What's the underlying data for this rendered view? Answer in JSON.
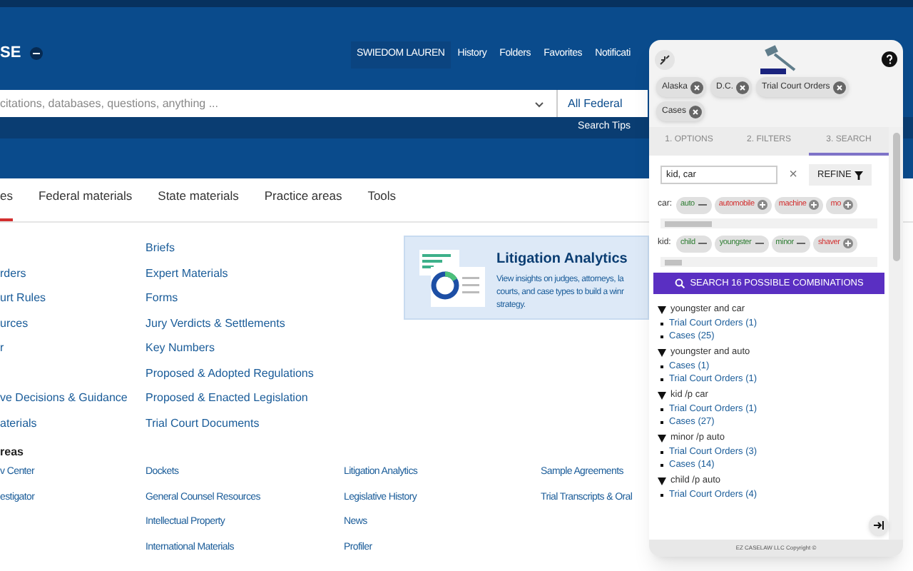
{
  "header": {
    "brand": "SE",
    "nav": [
      {
        "label": "SWIEDOM LAUREN",
        "selected": true
      },
      {
        "label": "History",
        "selected": false
      },
      {
        "label": "Folders",
        "selected": false
      },
      {
        "label": "Favorites",
        "selected": false
      },
      {
        "label": "Notificati",
        "selected": false
      }
    ],
    "search_placeholder": "citations, databases, questions, anything ...",
    "jurisdiction": "All Federal",
    "search_tips": "Search Tips"
  },
  "tabs": [
    {
      "label": "es",
      "selected": true
    },
    {
      "label": "Federal materials",
      "selected": false
    },
    {
      "label": "State materials",
      "selected": false
    },
    {
      "label": "Practice areas",
      "selected": false
    },
    {
      "label": "Tools",
      "selected": false
    }
  ],
  "content_columns": [
    [
      "",
      "rders",
      "urt Rules",
      "urces",
      "r",
      "",
      "ve Decisions & Guidance",
      "aterials"
    ],
    [
      "Briefs",
      "Expert Materials",
      "Forms",
      "Jury Verdicts & Settlements",
      "Key Numbers",
      "Proposed & Adopted Regulations",
      "Proposed & Enacted Legislation",
      "Trial Court Documents"
    ]
  ],
  "promo": {
    "title": "Litigation Analytics",
    "lines": [
      "View insights on judges, attorneys, la",
      "courts, and case types to build a winr",
      "strategy."
    ]
  },
  "section_heading": "reas",
  "section_columns": [
    [
      "v Center",
      "estigator"
    ],
    [
      "Dockets",
      "General Counsel Resources",
      "Intellectual Property",
      "International Materials"
    ],
    [
      "Litigation Analytics",
      "Legislative History",
      "News",
      "Profiler"
    ],
    [
      "Sample Agreements",
      "Trial Transcripts & Oral"
    ]
  ],
  "popup": {
    "filters": [
      "Alaska",
      "D.C.",
      "Trial Court Orders",
      "Cases"
    ],
    "tabs": [
      {
        "label": "1. OPTIONS",
        "selected": false
      },
      {
        "label": "2. FILTERS",
        "selected": false
      },
      {
        "label": "3. SEARCH",
        "selected": true
      }
    ],
    "query": "kid, car",
    "clear": "×",
    "refine": "REFINE",
    "terms": [
      {
        "label": "car:",
        "synonyms": [
          {
            "word": "auto",
            "included": true
          },
          {
            "word": "automobile",
            "included": false
          },
          {
            "word": "machine",
            "included": false
          },
          {
            "word": "mo",
            "included": false
          }
        ]
      },
      {
        "label": "kid:",
        "synonyms": [
          {
            "word": "child",
            "included": true
          },
          {
            "word": "youngster",
            "included": true
          },
          {
            "word": "minor",
            "included": true
          },
          {
            "word": "shaver",
            "included": false
          }
        ]
      }
    ],
    "search_button": "SEARCH 16 POSSIBLE COMBINATIONS",
    "results": [
      {
        "query": "youngster and car",
        "expanded": true,
        "children": [
          "Trial Court Orders (1)",
          "Cases (25)"
        ]
      },
      {
        "query": "youngster and auto",
        "expanded": true,
        "children": [
          "Cases (1)",
          "Trial Court Orders (1)"
        ]
      },
      {
        "query": "kid /p car",
        "expanded": true,
        "children": [
          "Trial Court Orders (1)",
          "Cases (27)"
        ]
      },
      {
        "query": "minor /p auto",
        "expanded": true,
        "children": [
          "Trial Court Orders (3)",
          "Cases (14)"
        ]
      },
      {
        "query": "child /p auto",
        "expanded": true,
        "children": [
          "Trial Court Orders (4)"
        ]
      }
    ],
    "footer": "EZ CASELAW LLC Copyright ©"
  }
}
